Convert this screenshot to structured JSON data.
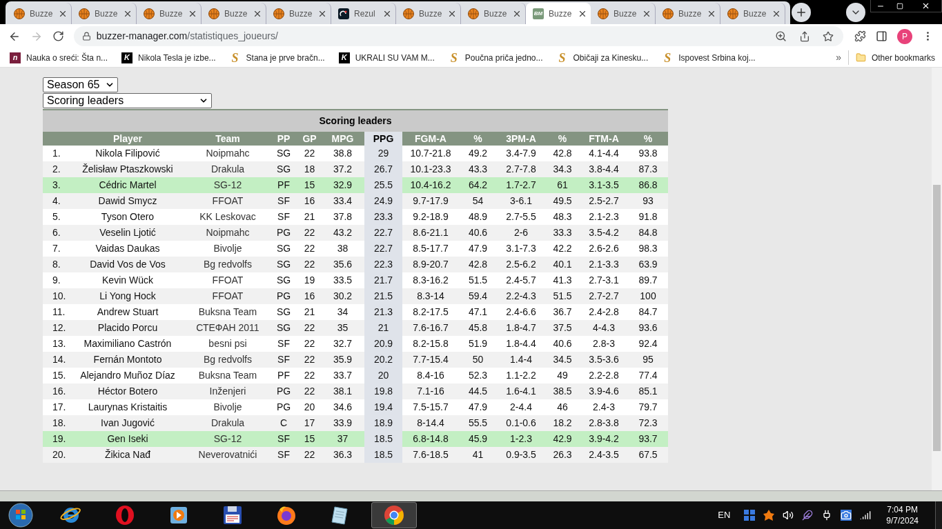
{
  "tabs": [
    {
      "title": "Buzze",
      "kind": "ball",
      "selected": false
    },
    {
      "title": "Buzze",
      "kind": "ball",
      "selected": false
    },
    {
      "title": "Buzze",
      "kind": "ball",
      "selected": false
    },
    {
      "title": "Buzze",
      "kind": "ball",
      "selected": false
    },
    {
      "title": "Buzze",
      "kind": "ball",
      "selected": false
    },
    {
      "title": "Rezul",
      "kind": "dark",
      "selected": false
    },
    {
      "title": "Buzze",
      "kind": "ball",
      "selected": false
    },
    {
      "title": "Buzze",
      "kind": "ball",
      "selected": false
    },
    {
      "title": "Buzze",
      "kind": "bm",
      "icon_text": "BM",
      "selected": true
    },
    {
      "title": "Buzze",
      "kind": "ball",
      "selected": false
    },
    {
      "title": "Buzze",
      "kind": "ball",
      "selected": false
    },
    {
      "title": "Buzze",
      "kind": "ball",
      "selected": false
    }
  ],
  "address": {
    "host": "buzzer-manager.com",
    "path": "/statistiques_joueurs/"
  },
  "profile": {
    "initial": "P"
  },
  "bookmarks": [
    {
      "title": "Nauka o sreći: Šta n...",
      "kind": "maroon",
      "icon_text": "n"
    },
    {
      "title": "Nikola Tesla je izbe...",
      "kind": "black",
      "icon_text": "K"
    },
    {
      "title": "Stana je prve bračn...",
      "kind": "script",
      "icon_text": "S"
    },
    {
      "title": "UKRALI SU VAM M...",
      "kind": "black",
      "icon_text": "K"
    },
    {
      "title": "Poučna priča jedno...",
      "kind": "script",
      "icon_text": "S"
    },
    {
      "title": "Običaji za Kinesku...",
      "kind": "script",
      "icon_text": "S"
    },
    {
      "title": "Ispovest Srbina koj...",
      "kind": "script",
      "icon_text": "S"
    }
  ],
  "more_bookmarks": "»",
  "other_bookmarks": "Other bookmarks",
  "season_select": "Season 65",
  "category_select": "Scoring leaders",
  "table": {
    "title": "Scoring leaders",
    "columns": [
      {
        "label": "Player",
        "sorted": false
      },
      {
        "label": "Team",
        "sorted": false
      },
      {
        "label": "PP",
        "sorted": false
      },
      {
        "label": "GP",
        "sorted": false
      },
      {
        "label": "MPG",
        "sorted": false
      },
      {
        "label": "PPG",
        "sorted": true
      },
      {
        "label": "FGM-A",
        "sorted": false
      },
      {
        "label": "%",
        "sorted": false
      },
      {
        "label": "3PM-A",
        "sorted": false
      },
      {
        "label": "%",
        "sorted": false
      },
      {
        "label": "FTM-A",
        "sorted": false
      },
      {
        "label": "%",
        "sorted": false
      }
    ],
    "rows": [
      {
        "rank": "1.",
        "cells": [
          "Nikola Filipović",
          "Noipmahc",
          "SG",
          "22",
          "38.8",
          "29",
          "10.7-21.8",
          "49.2",
          "3.4-7.9",
          "42.8",
          "4.1-4.4",
          "93.8"
        ],
        "highlighted": false
      },
      {
        "rank": "2.",
        "cells": [
          "Želisław Ptaszkowski",
          "Drakula",
          "SG",
          "18",
          "37.2",
          "26.7",
          "10.1-23.3",
          "43.3",
          "2.7-7.8",
          "34.3",
          "3.8-4.4",
          "87.3"
        ],
        "highlighted": false
      },
      {
        "rank": "3.",
        "cells": [
          "Cédric Martel",
          "SG-12",
          "PF",
          "15",
          "32.9",
          "25.5",
          "10.4-16.2",
          "64.2",
          "1.7-2.7",
          "61",
          "3.1-3.5",
          "86.8"
        ],
        "highlighted": true
      },
      {
        "rank": "4.",
        "cells": [
          "Dawid Smycz",
          "FFOAT",
          "SF",
          "16",
          "33.4",
          "24.9",
          "9.7-17.9",
          "54",
          "3-6.1",
          "49.5",
          "2.5-2.7",
          "93"
        ],
        "highlighted": false
      },
      {
        "rank": "5.",
        "cells": [
          "Tyson Otero",
          "KK Leskovac",
          "SF",
          "21",
          "37.8",
          "23.3",
          "9.2-18.9",
          "48.9",
          "2.7-5.5",
          "48.3",
          "2.1-2.3",
          "91.8"
        ],
        "highlighted": false
      },
      {
        "rank": "6.",
        "cells": [
          "Veselin Ljotić",
          "Noipmahc",
          "PG",
          "22",
          "43.2",
          "22.7",
          "8.6-21.1",
          "40.6",
          "2-6",
          "33.3",
          "3.5-4.2",
          "84.8"
        ],
        "highlighted": false
      },
      {
        "rank": "7.",
        "cells": [
          "Vaidas Daukas",
          "Bivolje",
          "SG",
          "22",
          "38",
          "22.7",
          "8.5-17.7",
          "47.9",
          "3.1-7.3",
          "42.2",
          "2.6-2.6",
          "98.3"
        ],
        "highlighted": false
      },
      {
        "rank": "8.",
        "cells": [
          "David Vos de Vos",
          "Bg redvolfs",
          "SG",
          "22",
          "35.6",
          "22.3",
          "8.9-20.7",
          "42.8",
          "2.5-6.2",
          "40.1",
          "2.1-3.3",
          "63.9"
        ],
        "highlighted": false
      },
      {
        "rank": "9.",
        "cells": [
          "Kevin Wück",
          "FFOAT",
          "SG",
          "19",
          "33.5",
          "21.7",
          "8.3-16.2",
          "51.5",
          "2.4-5.7",
          "41.3",
          "2.7-3.1",
          "89.7"
        ],
        "highlighted": false
      },
      {
        "rank": "10.",
        "cells": [
          "Li Yong Hock",
          "FFOAT",
          "PG",
          "16",
          "30.2",
          "21.5",
          "8.3-14",
          "59.4",
          "2.2-4.3",
          "51.5",
          "2.7-2.7",
          "100"
        ],
        "highlighted": false
      },
      {
        "rank": "11.",
        "cells": [
          "Andrew Stuart",
          "Buksna Team",
          "SG",
          "21",
          "34",
          "21.3",
          "8.2-17.5",
          "47.1",
          "2.4-6.6",
          "36.7",
          "2.4-2.8",
          "84.7"
        ],
        "highlighted": false
      },
      {
        "rank": "12.",
        "cells": [
          "Placido Porcu",
          "СТЕФАН 2011",
          "SG",
          "22",
          "35",
          "21",
          "7.6-16.7",
          "45.8",
          "1.8-4.7",
          "37.5",
          "4-4.3",
          "93.6"
        ],
        "highlighted": false
      },
      {
        "rank": "13.",
        "cells": [
          "Maximiliano Castrón",
          "besni psi",
          "SF",
          "22",
          "32.7",
          "20.9",
          "8.2-15.8",
          "51.9",
          "1.8-4.4",
          "40.6",
          "2.8-3",
          "92.4"
        ],
        "highlighted": false
      },
      {
        "rank": "14.",
        "cells": [
          "Fernán Montoto",
          "Bg redvolfs",
          "SF",
          "22",
          "35.9",
          "20.2",
          "7.7-15.4",
          "50",
          "1.4-4",
          "34.5",
          "3.5-3.6",
          "95"
        ],
        "highlighted": false
      },
      {
        "rank": "15.",
        "cells": [
          "Alejandro Muñoz Díaz",
          "Buksna Team",
          "PF",
          "22",
          "33.7",
          "20",
          "8.4-16",
          "52.3",
          "1.1-2.2",
          "49",
          "2.2-2.8",
          "77.4"
        ],
        "highlighted": false
      },
      {
        "rank": "16.",
        "cells": [
          "Héctor Botero",
          "Inženjeri",
          "PG",
          "22",
          "38.1",
          "19.8",
          "7.1-16",
          "44.5",
          "1.6-4.1",
          "38.5",
          "3.9-4.6",
          "85.1"
        ],
        "highlighted": false
      },
      {
        "rank": "17.",
        "cells": [
          "Laurynas Kristaitis",
          "Bivolje",
          "PG",
          "20",
          "34.6",
          "19.4",
          "7.5-15.7",
          "47.9",
          "2-4.4",
          "46",
          "2.4-3",
          "79.7"
        ],
        "highlighted": false
      },
      {
        "rank": "18.",
        "cells": [
          "Ivan Jugović",
          "Drakula",
          "C",
          "17",
          "33.9",
          "18.9",
          "8-14.4",
          "55.5",
          "0.1-0.6",
          "18.2",
          "2.8-3.8",
          "72.3"
        ],
        "highlighted": false
      },
      {
        "rank": "19.",
        "cells": [
          "Gen Iseki",
          "SG-12",
          "SF",
          "15",
          "37",
          "18.5",
          "6.8-14.8",
          "45.9",
          "1-2.3",
          "42.9",
          "3.9-4.2",
          "93.7"
        ],
        "highlighted": true
      },
      {
        "rank": "20.",
        "cells": [
          "Žikica Nađ",
          "Neverovatnići",
          "SF",
          "22",
          "36.3",
          "18.5",
          "7.6-18.5",
          "41",
          "0.9-3.5",
          "26.3",
          "2.4-3.5",
          "67.5"
        ],
        "highlighted": false
      }
    ]
  },
  "taskbar": {
    "apps": [
      {
        "kind": "ie",
        "selected": false
      },
      {
        "kind": "opera",
        "selected": false
      },
      {
        "kind": "media",
        "selected": false
      },
      {
        "kind": "floppy",
        "selected": false
      },
      {
        "kind": "firefox",
        "selected": false
      },
      {
        "kind": "notepad",
        "selected": false
      },
      {
        "kind": "chrome",
        "selected": true
      }
    ],
    "language": "EN",
    "time": "7:04 PM",
    "date": "9/7/2024"
  }
}
